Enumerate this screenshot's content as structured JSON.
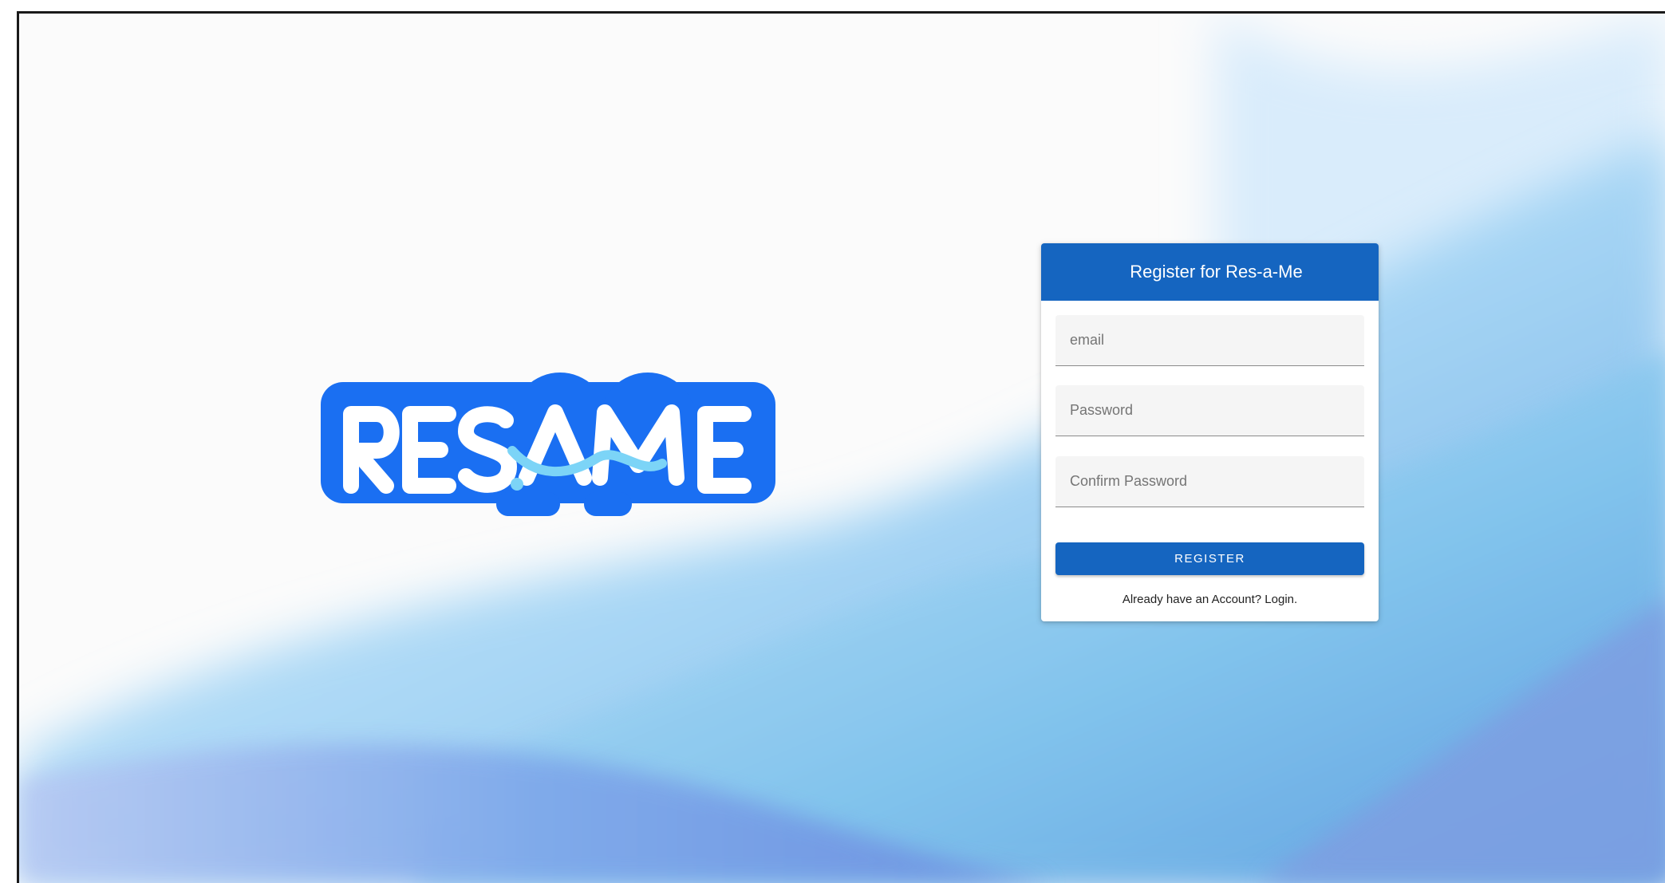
{
  "logo": {
    "text": "RES-A-ME"
  },
  "register_card": {
    "title": "Register for Res-a-Me",
    "email_placeholder": "email",
    "password_placeholder": "Password",
    "confirm_placeholder": "Confirm Password",
    "register_label": "REGISTER",
    "already_text": "Already have an Account? ",
    "login_label": "Login."
  },
  "colors": {
    "primary": "#1565c0",
    "logo_blue": "#1a6ff2",
    "logo_light": "#7cd4f7"
  }
}
